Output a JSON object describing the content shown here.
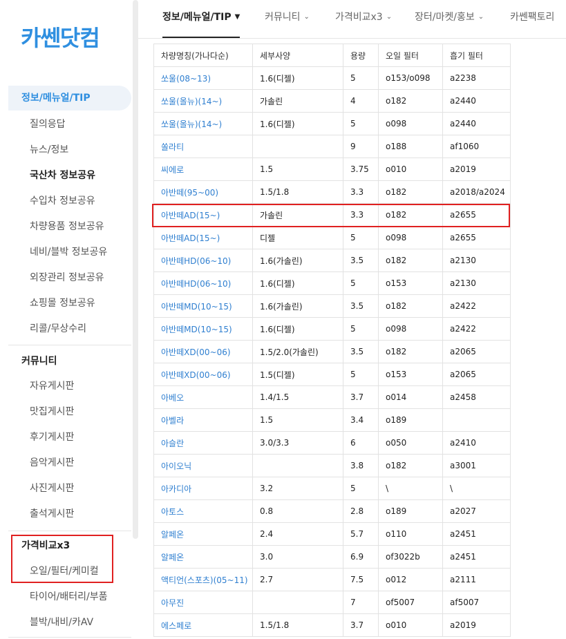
{
  "logo": "카쎈닷컴",
  "nav": {
    "tabs": [
      {
        "label": "정보/메뉴얼/TIP"
      },
      {
        "label": "커뮤니티"
      },
      {
        "label": "가격비교x3"
      },
      {
        "label": "장터/마켓/홍보"
      },
      {
        "label": "카쎈팩토리"
      }
    ]
  },
  "sidebar": {
    "info_head": "정보/메뉴얼/TIP",
    "info_items": [
      "질의응답",
      "뉴스/정보",
      "국산차 정보공유",
      "수입차 정보공유",
      "차량용품 정보공유",
      "네비/블박 정보공유",
      "외장관리 정보공유",
      "쇼핑몰 정보공유",
      "리콜/무상수리"
    ],
    "community_head": "커뮤니티",
    "community_items": [
      "자유게시판",
      "맛집게시판",
      "후기게시판",
      "음악게시판",
      "사진게시판",
      "출석게시판"
    ],
    "price_head": "가격비교x3",
    "price_items": [
      "오일/필터/케미컬",
      "타이어/배터리/부품",
      "블박/내비/카AV"
    ]
  },
  "table": {
    "headers": [
      "차량명칭(가나다순)",
      "세부사양",
      "용량",
      "오일 필터",
      "흡기 필터"
    ],
    "rows": [
      [
        "쏘울(08~13)",
        "1.6(디젤)",
        "5",
        "o153/o098",
        "a2238"
      ],
      [
        "쏘울(올뉴)(14~)",
        "가솔린",
        "4",
        "o182",
        "a2440"
      ],
      [
        "쏘울(올뉴)(14~)",
        "1.6(디젤)",
        "5",
        "o098",
        "a2440"
      ],
      [
        "쏠라티",
        "",
        "9",
        "o188",
        "af1060"
      ],
      [
        "씨에로",
        "1.5",
        "3.75",
        "o010",
        "a2019"
      ],
      [
        "아반떼(95~00)",
        "1.5/1.8",
        "3.3",
        "o182",
        "a2018/a2024"
      ],
      [
        "아반떼AD(15~)",
        "가솔린",
        "3.3",
        "o182",
        "a2655"
      ],
      [
        "아반떼AD(15~)",
        "디젤",
        "5",
        "o098",
        "a2655"
      ],
      [
        "아반떼HD(06~10)",
        "1.6(가솔린)",
        "3.5",
        "o182",
        "a2130"
      ],
      [
        "아반떼HD(06~10)",
        "1.6(디젤)",
        "5",
        "o153",
        "a2130"
      ],
      [
        "아반떼MD(10~15)",
        "1.6(가솔린)",
        "3.5",
        "o182",
        "a2422"
      ],
      [
        "아반떼MD(10~15)",
        "1.6(디젤)",
        "5",
        "o098",
        "a2422"
      ],
      [
        "아반떼XD(00~06)",
        "1.5/2.0(가솔린)",
        "3.5",
        "o182",
        "a2065"
      ],
      [
        "아반떼XD(00~06)",
        "1.5(디젤)",
        "5",
        "o153",
        "a2065"
      ],
      [
        "아베오",
        "1.4/1.5",
        "3.7",
        "o014",
        "a2458"
      ],
      [
        "아벨라",
        "1.5",
        "3.4",
        "o189",
        ""
      ],
      [
        "아슬란",
        "3.0/3.3",
        "6",
        "o050",
        "a2410"
      ],
      [
        "아이오닉",
        "",
        "3.8",
        "o182",
        "a3001"
      ],
      [
        "아카디아",
        "3.2",
        "5",
        "\\",
        "\\"
      ],
      [
        "아토스",
        "0.8",
        "2.8",
        "o189",
        "a2027"
      ],
      [
        "알페온",
        "2.4",
        "5.7",
        "o110",
        "a2451"
      ],
      [
        "알페온",
        "3.0",
        "6.9",
        "of3022b",
        "a2451"
      ],
      [
        "액티언(스포츠)(05~11)",
        "2.7",
        "7.5",
        "o012",
        "a2111"
      ],
      [
        "아무진",
        "",
        "7",
        "of5007",
        "af5007"
      ],
      [
        "에스페로",
        "1.5/1.8",
        "3.7",
        "o010",
        "a2019"
      ]
    ]
  }
}
